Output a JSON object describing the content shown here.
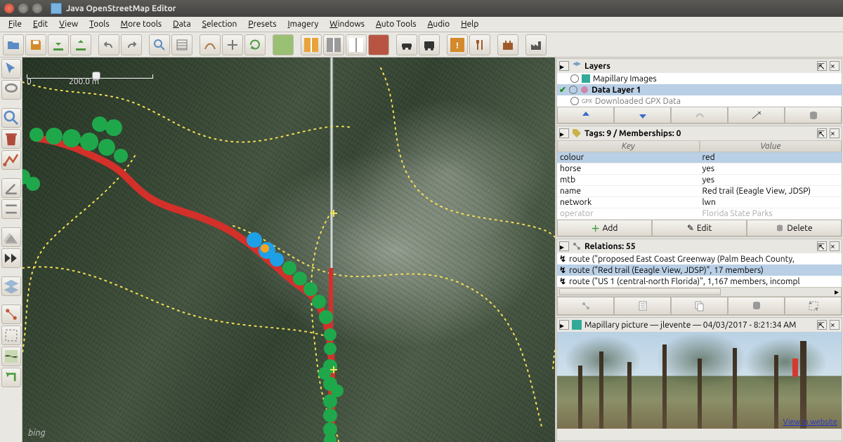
{
  "window": {
    "title": "Java OpenStreetMap Editor"
  },
  "menubar": [
    "File",
    "Edit",
    "View",
    "Tools",
    "More tools",
    "Data",
    "Selection",
    "Presets",
    "Imagery",
    "Windows",
    "Auto Tools",
    "Audio",
    "Help"
  ],
  "scale": {
    "zero": "0",
    "dist": "200.0 m"
  },
  "attribution": "bing",
  "layers_panel": {
    "title": "Layers",
    "items": [
      {
        "name": "Mapillary Images",
        "active": false
      },
      {
        "name": "Data Layer 1",
        "active": true
      },
      {
        "name": "Downloaded GPX Data",
        "active": false
      }
    ]
  },
  "tags_panel": {
    "title": "Tags: 9 / Memberships: 0",
    "headers": {
      "key": "Key",
      "value": "Value"
    },
    "rows": [
      {
        "k": "colour",
        "v": "red",
        "sel": true
      },
      {
        "k": "horse",
        "v": "yes"
      },
      {
        "k": "mtb",
        "v": "yes"
      },
      {
        "k": "name",
        "v": "Red trail (Eeagle View, JDSP)"
      },
      {
        "k": "network",
        "v": "lwn"
      },
      {
        "k": "operator",
        "v": "Florida State Parks"
      }
    ],
    "buttons": {
      "add": "Add",
      "edit": "Edit",
      "delete": "Delete"
    }
  },
  "relations_panel": {
    "title": "Relations: 55",
    "items": [
      {
        "label": "route (\"proposed East Coast Greenway (Palm Beach County,",
        "sel": false
      },
      {
        "label": "route (\"Red trail (Eeagle View, JDSP)\", 17 members)",
        "sel": true
      },
      {
        "label": "route (\"US 1 (central-north Florida)\", 1,167 members, incompl",
        "sel": false
      }
    ]
  },
  "mapillary_panel": {
    "title": "Mapillary picture — jlevente — 04/03/2017 - 8:21:34 AM",
    "link": "View in website"
  }
}
